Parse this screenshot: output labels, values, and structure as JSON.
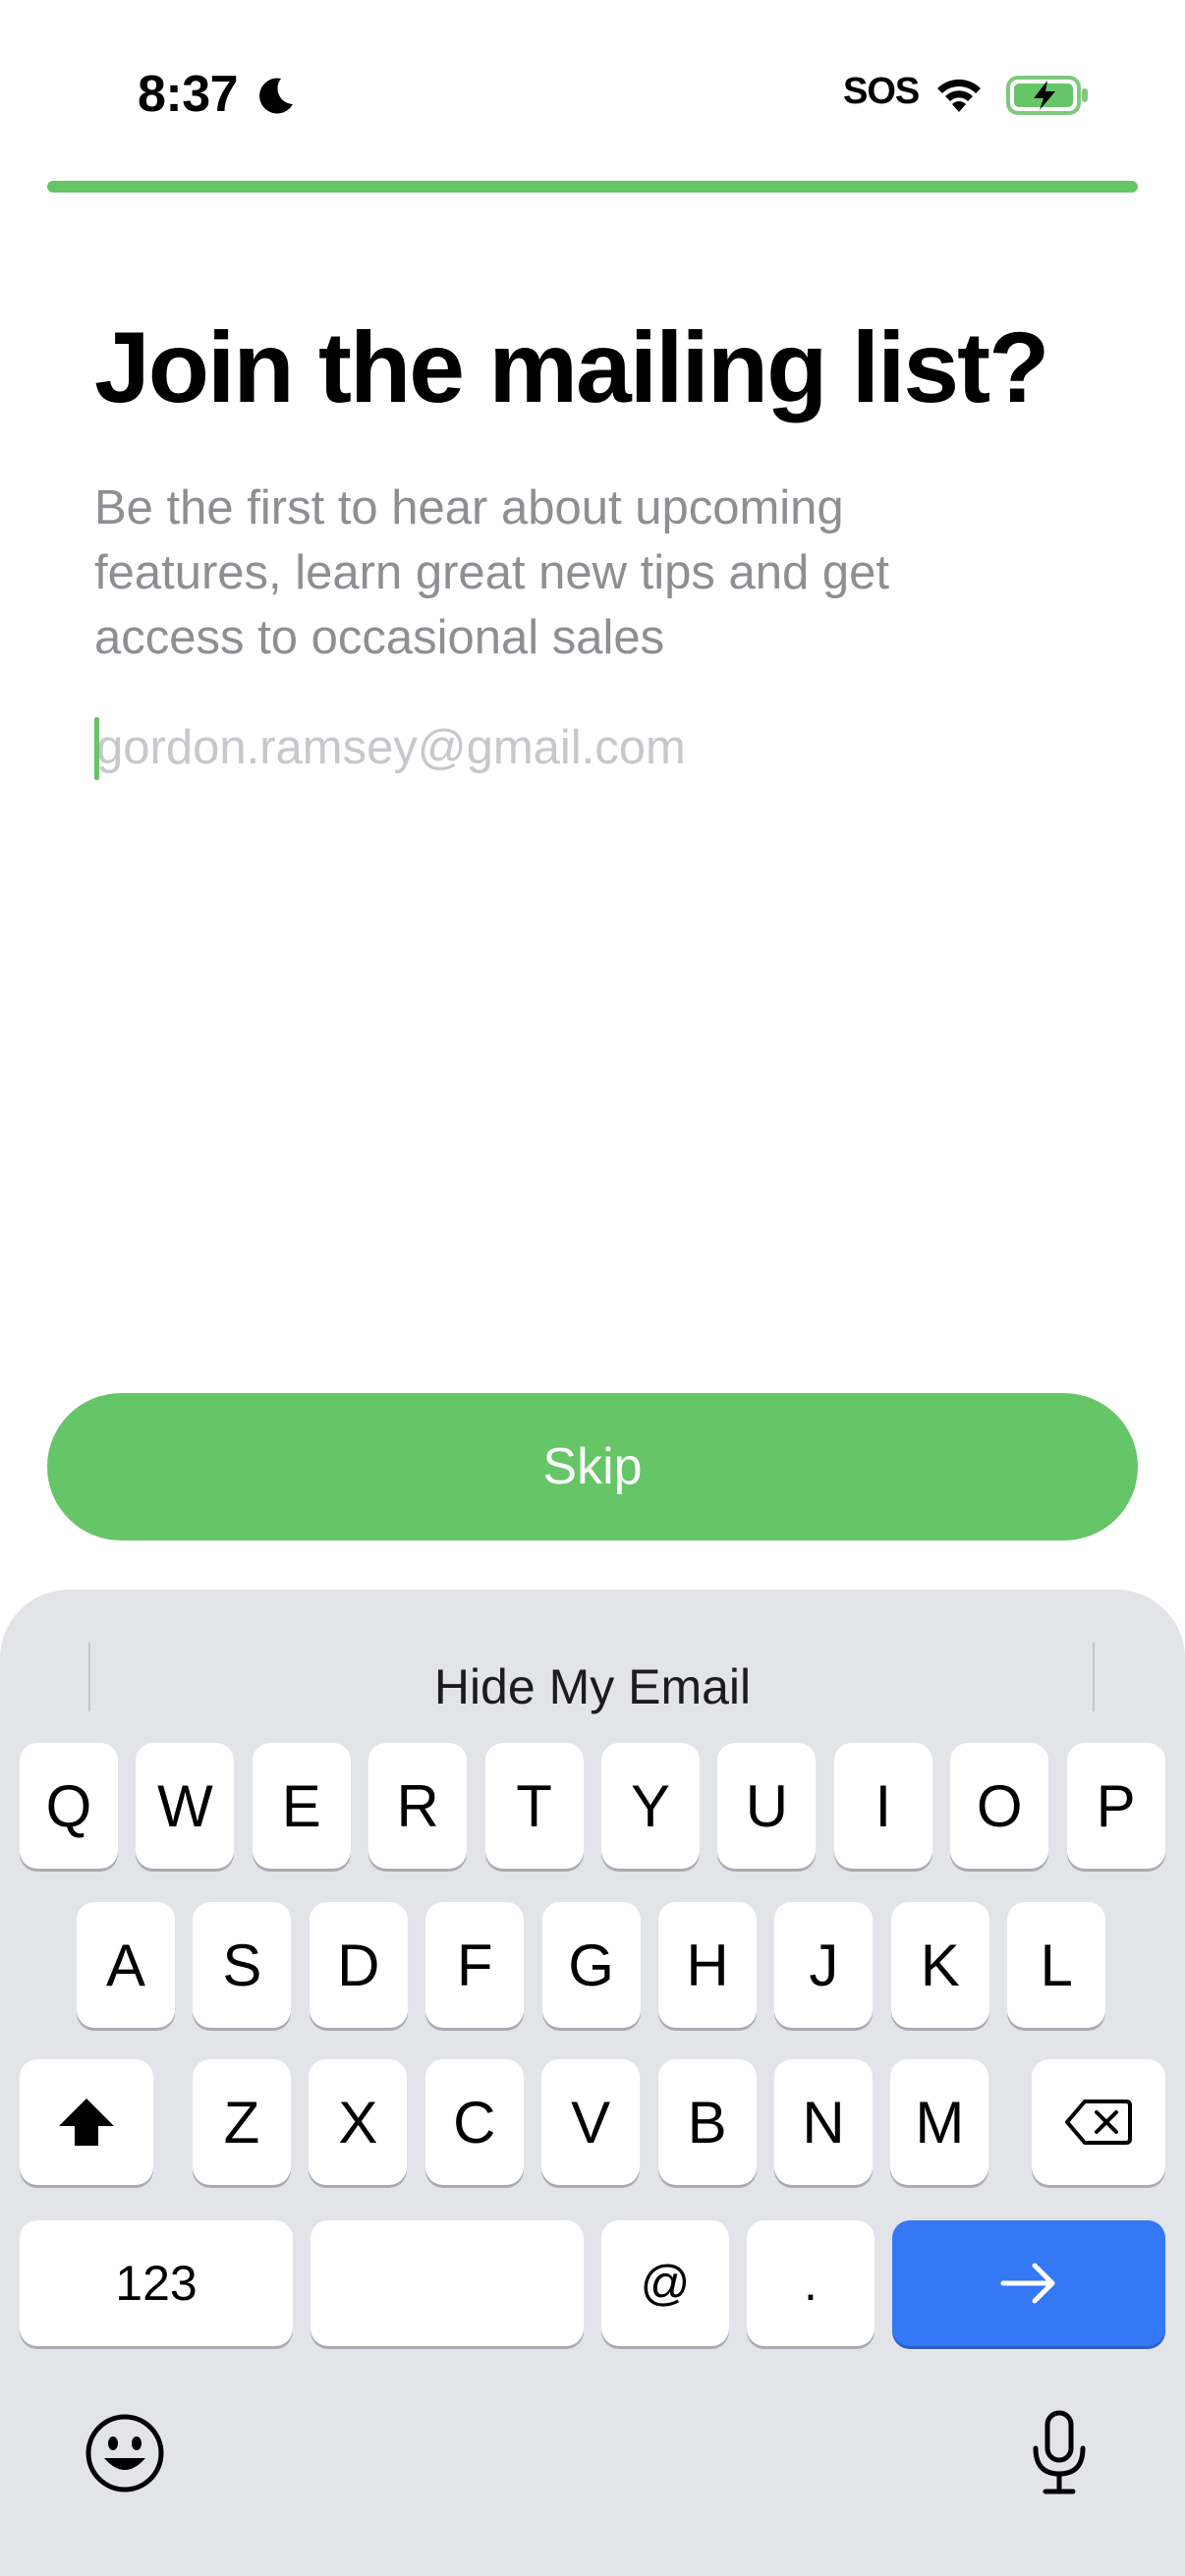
{
  "status_bar": {
    "time": "8:37",
    "carrier": "SOS",
    "moon_icon": "moon-icon",
    "wifi_icon": "wifi-icon",
    "battery_icon": "battery-charging-icon"
  },
  "progress": {
    "fraction": 1.0,
    "color": "#66c566"
  },
  "content": {
    "title": "Join the mailing list?",
    "subtitle": "Be the first to hear about upcoming features, learn great new tips and get access to occasional sales",
    "email_placeholder": "gordon.ramsey@gmail.com",
    "email_value": ""
  },
  "skip_button": {
    "label": "Skip",
    "color": "#66c566"
  },
  "keyboard": {
    "suggestion": "Hide My Email",
    "row1": [
      "Q",
      "W",
      "E",
      "R",
      "T",
      "Y",
      "U",
      "I",
      "O",
      "P"
    ],
    "row2": [
      "A",
      "S",
      "D",
      "F",
      "G",
      "H",
      "J",
      "K",
      "L"
    ],
    "row3": [
      "Z",
      "X",
      "C",
      "V",
      "B",
      "N",
      "M"
    ],
    "numbers_label": "123",
    "at_label": "@",
    "dot_label": ".",
    "go_color": "#3478f6",
    "shift_icon": "shift-icon",
    "delete_icon": "delete-icon",
    "go_icon": "arrow-right-icon",
    "emoji_icon": "emoji-icon",
    "mic_icon": "microphone-icon"
  }
}
